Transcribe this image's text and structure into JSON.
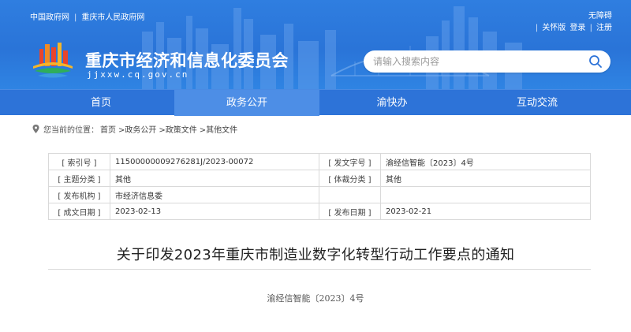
{
  "header": {
    "top_links": [
      "中国政府网",
      "重庆市人民政府网"
    ],
    "utility": {
      "accessibility": "无障碍",
      "elder_care": "关怀版",
      "login": "登录",
      "register": "注册"
    },
    "site_title": "重庆市经济和信息化委员会",
    "site_url": "jjxxw.cq.gov.cn",
    "search": {
      "placeholder": "请输入搜索内容"
    }
  },
  "nav": {
    "items": [
      {
        "label": "首页"
      },
      {
        "label": "政务公开",
        "active": true
      },
      {
        "label": "渝快办"
      },
      {
        "label": "互动交流"
      }
    ]
  },
  "breadcrumb": {
    "prefix": "您当前的位置：",
    "items": [
      "首页",
      ">政务公开",
      ">政策文件",
      ">其他文件"
    ]
  },
  "meta": {
    "rows": [
      {
        "k1": "[ 索引号 ]",
        "v1": "11500000009276281J/2023-00072",
        "k2": "[ 发文字号 ]",
        "v2": "渝经信智能〔2023〕4号"
      },
      {
        "k1": "[ 主题分类 ]",
        "v1": "其他",
        "k2": "[ 体裁分类 ]",
        "v2": "其他"
      },
      {
        "k1": "[ 发布机构 ]",
        "v1": "市经济信息委",
        "k2": "",
        "v2": ""
      },
      {
        "k1": "[ 成文日期 ]",
        "v1": "2023-02-13",
        "k2": "[ 发布日期 ]",
        "v2": "2023-02-21"
      }
    ]
  },
  "document": {
    "title": "关于印发2023年重庆市制造业数字化转型行动工作要点的通知",
    "number": "渝经信智能〔2023〕4号"
  },
  "colors": {
    "header_blue": "#2a74d8",
    "nav_blue": "#2d73d8",
    "nav_active": "#4d8ee6"
  }
}
